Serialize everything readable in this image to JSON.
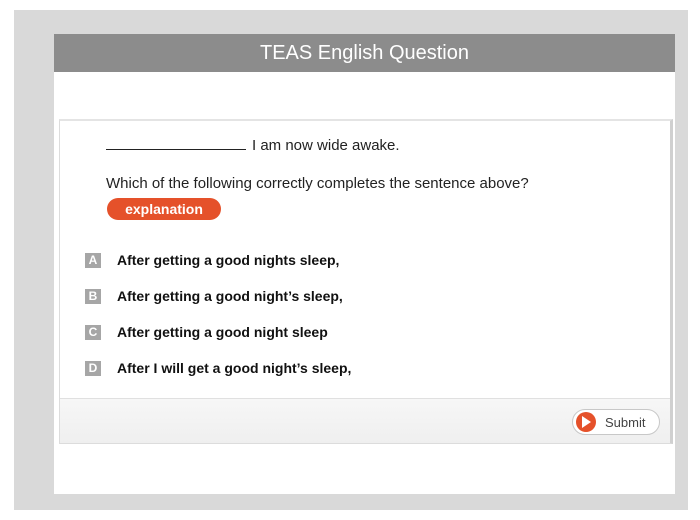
{
  "header": {
    "title": "TEAS English Question"
  },
  "question": {
    "sentence_rest": "I am now wide awake.",
    "prompt": "Which of the following correctly completes the sentence above?",
    "explanation_label": "explanation"
  },
  "options": [
    {
      "letter": "A",
      "text": "After getting a good nights sleep,"
    },
    {
      "letter": "B",
      "text": "After getting a good night’s sleep,"
    },
    {
      "letter": "C",
      "text": "After getting a good night sleep"
    },
    {
      "letter": "D",
      "text": "After I will get a good night’s sleep,"
    }
  ],
  "footer": {
    "submit_label": "Submit",
    "submit_icon": "play-circle-icon"
  },
  "colors": {
    "accent": "#e5512a",
    "header_bg": "#8c8c8c",
    "frame_bg": "#d9d9d9"
  }
}
